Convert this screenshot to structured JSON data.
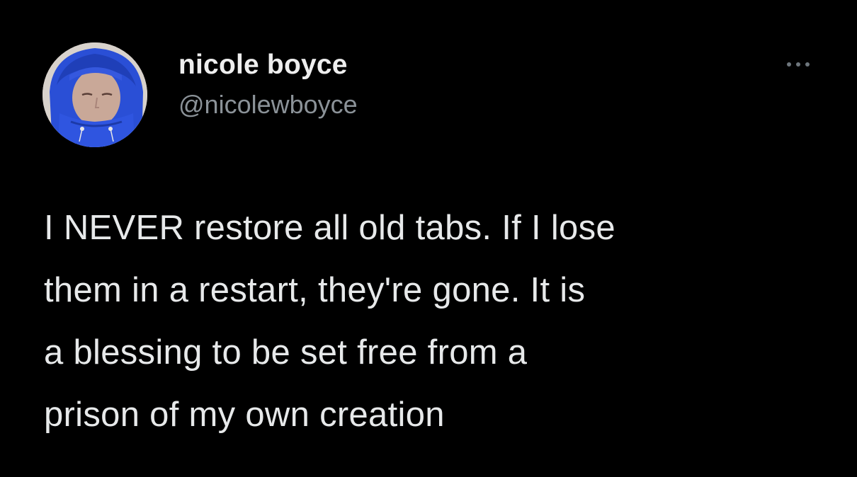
{
  "tweet": {
    "author": {
      "display_name": "nicole boyce",
      "handle": "@nicolewboyce",
      "avatar_icon": "profile-photo"
    },
    "more_icon": "more-horizontal-icon",
    "text_lines": [
      "I NEVER restore all old tabs. If I lose",
      "them in a restart, they're gone. It is",
      "a blessing to be set free from a",
      "prison of my own creation"
    ]
  },
  "colors": {
    "background": "#000000",
    "name": "#eeeeee",
    "handle": "#8b9298",
    "text": "#e7e9ea",
    "hood": "#2a4fd6"
  }
}
